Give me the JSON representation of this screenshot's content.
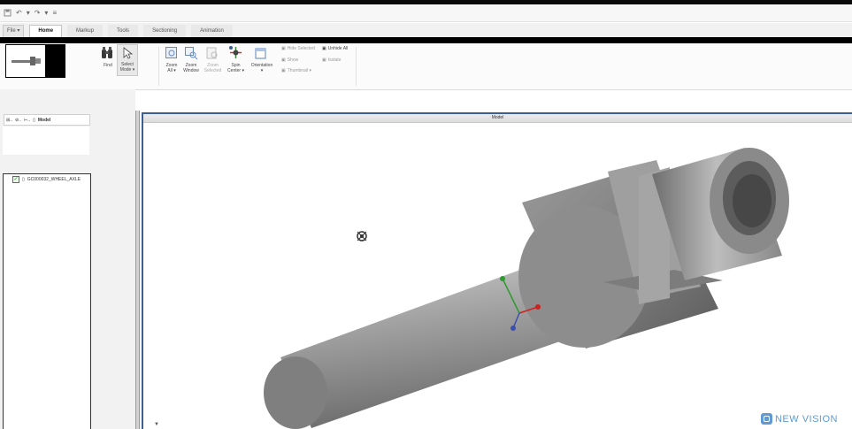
{
  "quick_access": {
    "undo": "↶",
    "redo": "↷",
    "customize": "≡"
  },
  "tabs": {
    "file": "File ▾",
    "home": "Home",
    "markup": "Markup",
    "tools": "Tools",
    "sectioning": "Sectioning",
    "animation": "Animation"
  },
  "ribbon": {
    "find": "Find",
    "select": "Select",
    "select_mode": "Mode ▾",
    "zoom_all_1": "Zoom",
    "zoom_all_2": "All ▾",
    "zoom_window_1": "Zoom",
    "zoom_window_2": "Window",
    "zoom_selected_1": "Zoom",
    "zoom_selected_2": "Selected",
    "spin_center_1": "Spin",
    "spin_center_2": "Center ▾",
    "orientation": "Orientation",
    "orientation_caret": "▾",
    "hide_selected": "Hide Selected",
    "show": "Show",
    "thumbnail": "Thumbnail ▾",
    "unhide_all": "Unhide All",
    "isolate": "Isolate"
  },
  "panel": {
    "tab_model": "Model",
    "tree_item": "GC000032_WHEEL_AXLE"
  },
  "viewport": {
    "title": "Model"
  },
  "logo": {
    "text": "NEW VISION"
  },
  "colors": {
    "accent": "#3b5f95",
    "logo": "#5f9bd2",
    "part_gray": "#8a8a8a"
  }
}
